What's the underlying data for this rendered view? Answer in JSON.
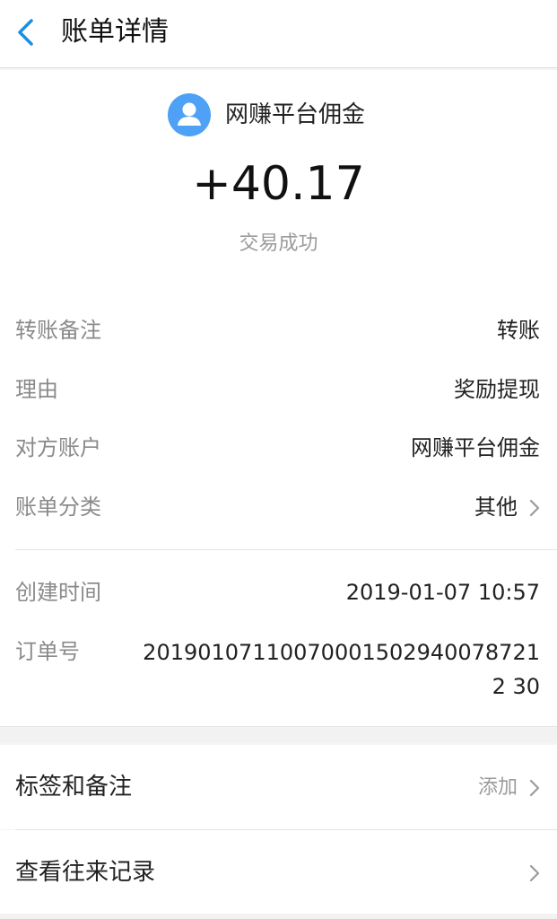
{
  "header": {
    "title": "账单详情",
    "back_icon": "back-chevron-icon"
  },
  "payee": {
    "name": "网赚平台佣金",
    "avatar_icon": "user-avatar-icon",
    "avatar_color": "#4ea1f5"
  },
  "amount": "+40.17",
  "status": "交易成功",
  "details": [
    {
      "label": "转账备注",
      "value": "转账"
    },
    {
      "label": "理由",
      "value": "奖励提现"
    },
    {
      "label": "对方账户",
      "value": "网赚平台佣金"
    },
    {
      "label": "账单分类",
      "value": "其他"
    }
  ],
  "meta": {
    "created_label": "创建时间",
    "created_value": "2019-01-07 10:57",
    "order_label": "订单号",
    "order_value": "201901071100700015029400787212 30"
  },
  "actions": {
    "tags_label": "标签和备注",
    "tags_value": "添加",
    "history_label": "查看往来记录"
  },
  "colors": {
    "accent": "#1a8fe3",
    "muted": "#9b9b9b"
  }
}
